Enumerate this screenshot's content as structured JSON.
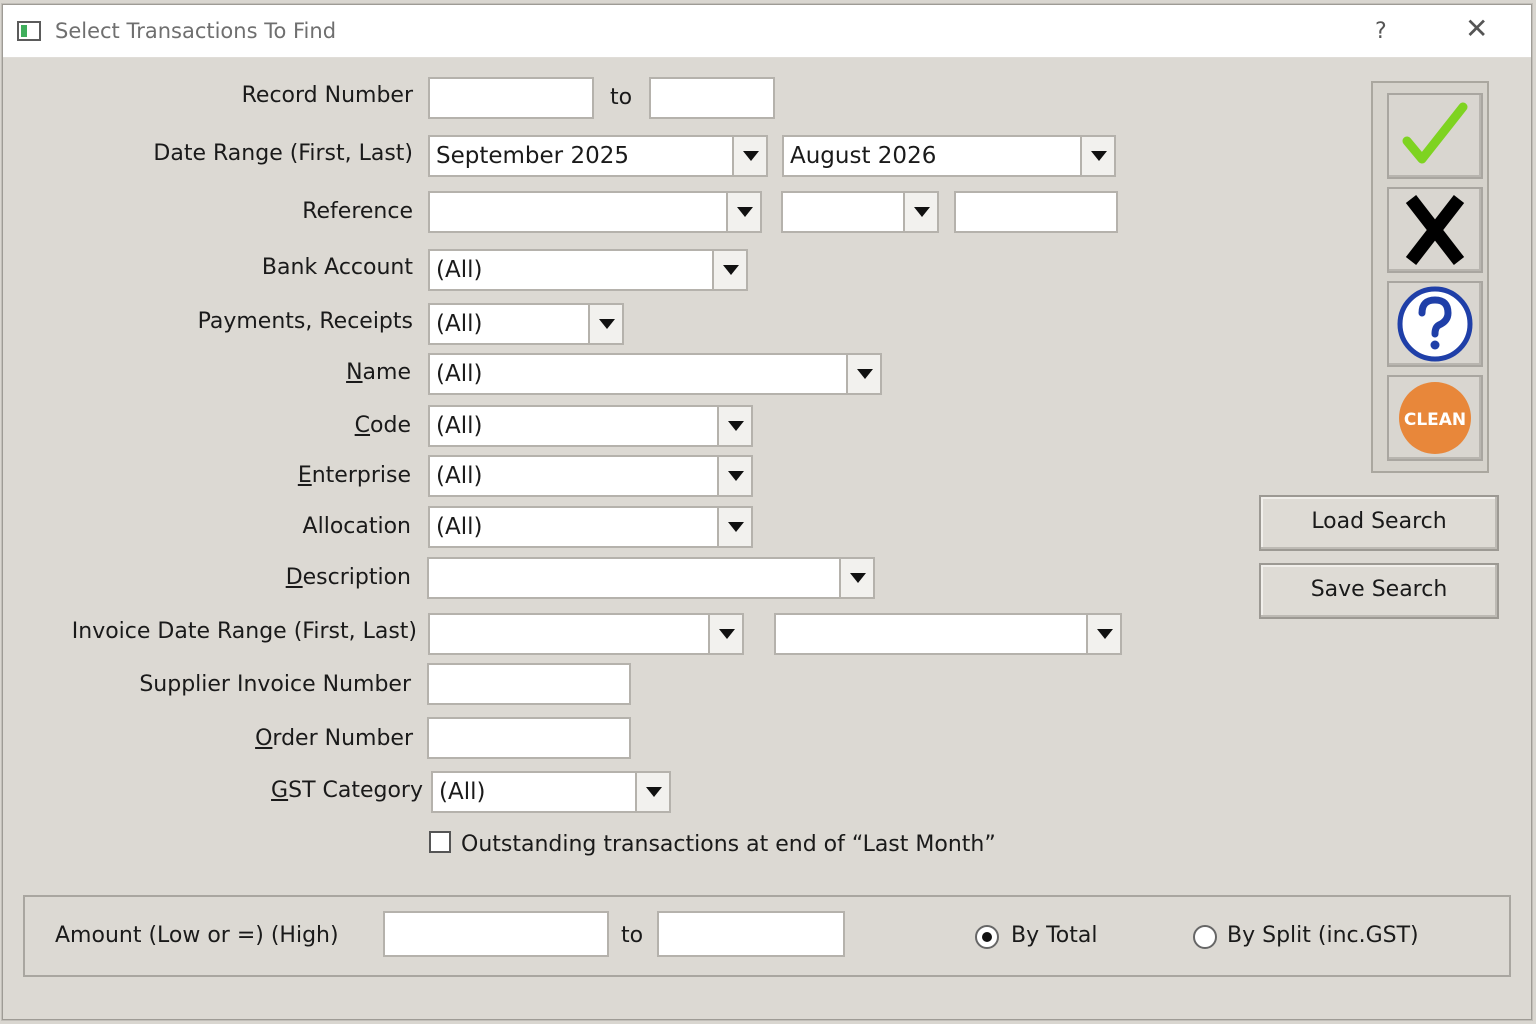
{
  "window": {
    "title": "Select Transactions To Find",
    "help": "?",
    "close": "✕"
  },
  "form": {
    "record_number": {
      "label": "Record Number",
      "from": "",
      "to_label": "to",
      "to": ""
    },
    "date_range": {
      "label": "Date Range (First, Last)",
      "first": "September 2025",
      "last": "August 2026"
    },
    "reference": {
      "label": "Reference",
      "value1": "",
      "value2": "",
      "value3": ""
    },
    "bank_account": {
      "label": "Bank Account",
      "value": "(All)"
    },
    "payments_receipts": {
      "label": "Payments, Receipts",
      "value": "(All)"
    },
    "name": {
      "label_u": "N",
      "label_rest": "ame",
      "value": "(All)"
    },
    "code": {
      "label_u": "C",
      "label_rest": "ode",
      "value": "(All)"
    },
    "enterprise": {
      "label_u": "E",
      "label_rest": "nterprise",
      "value": "(All)"
    },
    "allocation": {
      "label": "Allocation",
      "value": "(All)"
    },
    "description": {
      "label_u": "D",
      "label_rest": "escription",
      "value": ""
    },
    "invoice_date_range": {
      "label": "Invoice Date Range (First, Last)",
      "first": "",
      "last": ""
    },
    "supplier_invoice_number": {
      "label": "Supplier Invoice Number",
      "value": ""
    },
    "order_number": {
      "label_u": "O",
      "label_rest": "rder Number",
      "value": ""
    },
    "gst_category": {
      "label_u": "G",
      "label_rest": "ST Category",
      "value": "(All)"
    },
    "outstanding": {
      "label": "Outstanding transactions at end of “Last Month”",
      "checked": false
    }
  },
  "amount": {
    "label": "Amount (Low or =) (High)",
    "low": "",
    "to_label": "to",
    "high": "",
    "by_total": "By Total",
    "by_split": "By Split (inc.GST)",
    "selected": "by_total"
  },
  "toolbar": {
    "ok_icon": "checkmark-icon",
    "cancel_icon": "x-icon",
    "help_icon": "question-icon",
    "clean_label": "CLEAN",
    "check_color": "#7ed321",
    "help_color": "#1f3fa8",
    "clean_color": "#e8873a"
  },
  "buttons": {
    "load_search": "Load Search",
    "save_search": "Save Search"
  }
}
